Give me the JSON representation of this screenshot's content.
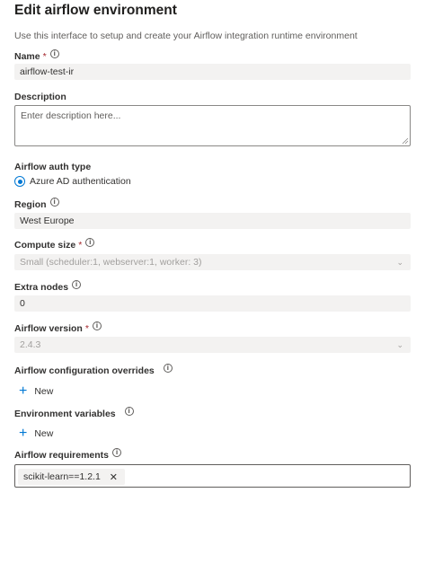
{
  "header": {
    "title": "Edit airflow environment",
    "subtitle": "Use this interface to setup and create your Airflow integration runtime environment"
  },
  "name": {
    "label": "Name",
    "required": "*",
    "value": "airflow-test-ir"
  },
  "description": {
    "label": "Description",
    "placeholder": "Enter description here..."
  },
  "auth": {
    "label": "Airflow auth type",
    "option": "Azure AD authentication",
    "selected": true
  },
  "region": {
    "label": "Region",
    "value": "West Europe"
  },
  "compute_size": {
    "label": "Compute size",
    "required": "*",
    "value": "Small (scheduler:1, webserver:1, worker: 3)"
  },
  "extra_nodes": {
    "label": "Extra nodes",
    "value": "0"
  },
  "airflow_version": {
    "label": "Airflow version",
    "required": "*",
    "value": "2.4.3"
  },
  "config_overrides": {
    "label": "Airflow configuration overrides",
    "add_label": "New"
  },
  "env_vars": {
    "label": "Environment variables",
    "add_label": "New"
  },
  "requirements": {
    "label": "Airflow requirements",
    "tags": [
      "scikit-learn==1.2.1"
    ]
  },
  "colors": {
    "accent": "#0078d4",
    "field_bg": "#f3f2f1",
    "disabled_text": "#a19f9d"
  },
  "icons": {
    "info": "info-icon",
    "chevron": "chevron-down-icon",
    "add": "plus-icon",
    "remove": "close-icon"
  }
}
